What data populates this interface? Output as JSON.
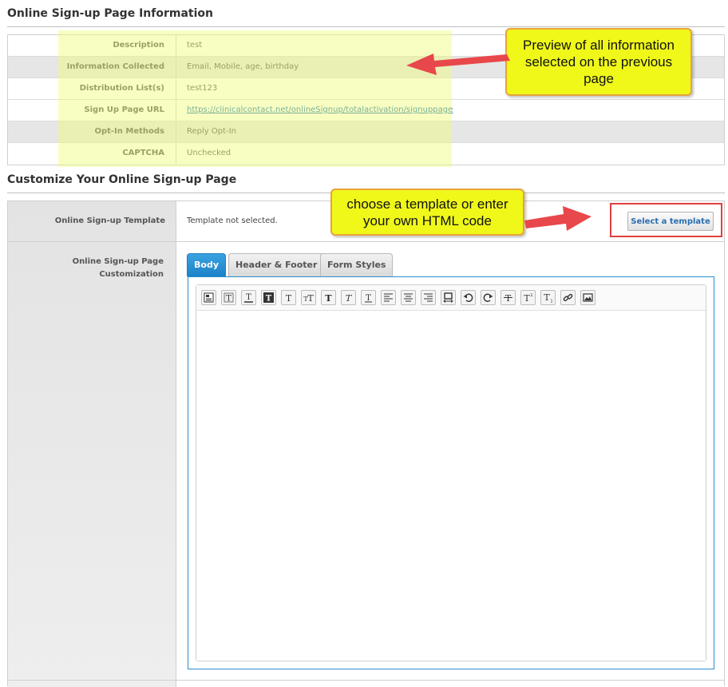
{
  "info_section": {
    "title": "Online Sign-up Page Information",
    "rows": [
      {
        "label": "Description",
        "value": "test"
      },
      {
        "label": "Information Collected",
        "value": "Email, Mobile, age, birthday"
      },
      {
        "label": "Distribution List(s)",
        "value": "test123"
      },
      {
        "label": "Sign Up Page URL",
        "value": "https://clinicalcontact.net/onlineSignup/totalactivation/signuppage"
      },
      {
        "label": "Opt-In Methods",
        "value": "Reply Opt-In"
      },
      {
        "label": "CAPTCHA",
        "value": "Unchecked"
      }
    ]
  },
  "customize_section": {
    "title": "Customize Your Online Sign-up Page",
    "template_label": "Online Sign-up Template",
    "template_status": "Template not selected.",
    "select_template_label": "Select a template",
    "customization_label_line1": "Online Sign-up Page",
    "customization_label_line2": "Customization",
    "tabs": [
      {
        "label": "Body",
        "active": true
      },
      {
        "label": "Header & Footer",
        "active": false
      },
      {
        "label": "Form Styles",
        "active": false
      }
    ]
  },
  "toolbar_icons": [
    "source-icon",
    "text-style-icon",
    "text-underline-style-icon",
    "bold-box-icon",
    "text-icon",
    "font-size-icon",
    "bold-icon",
    "italic-icon",
    "underline-icon",
    "align-left-icon",
    "align-center-icon",
    "align-right-icon",
    "resize-icon",
    "undo-icon",
    "redo-icon",
    "strikethrough-icon",
    "superscript-icon",
    "subscript-icon",
    "link-icon",
    "image-icon"
  ],
  "callouts": {
    "preview": "Preview of all information selected on the previous page",
    "template": "choose a template or enter your own HTML code"
  },
  "colors": {
    "callout_fill": "#f0f81a",
    "callout_border": "#e8a33a",
    "arrow": "#e8474b",
    "active_tab": "#1d82c8",
    "link": "#1a6fb0",
    "highlight_frame": "#e04040"
  }
}
